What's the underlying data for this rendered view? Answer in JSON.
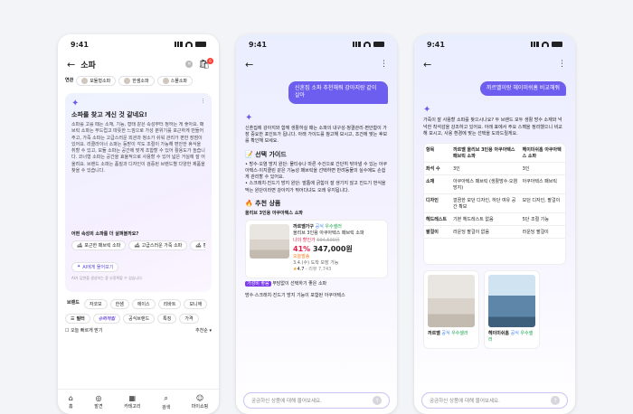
{
  "status_time": "9:41",
  "phone1": {
    "title": "소파",
    "cart_badge": "6",
    "related_label": "연관",
    "related": [
      "모듈형소파",
      "한샘소파",
      "스몰소파"
    ],
    "ai_title": "소파를 찾고 계신 것 같네요!",
    "ai_body": "소파를 고를 때는 소재, 기능, 형태 같은 속성부터 정하는 게 좋아요. 패브릭 소파는 부드럽고 따뜻한 느낌으로 가성 분위기를 포근하게 만들어주고, 가죽 소파는 고급스러운 외관과 청소가 쉬워 관리가 편한 장점이 있어요. 리클라이너 소파는 등받이 각도 조절이 가능해 편안한 휴식을 취할 수 있고, 모듈 소파는 공간에 맞게 조합할 수 있어 활용도가 높습니다. 코너형 소파는 공간을 효율적으로 사용할 수 있어 넓은 거실에 잘 어울려요. 브랜드 소파는 품질과 디자인이 검증된 브랜드별 다양한 제품을 찾을 수 있습니다.",
    "ai_question": "어떤 속성의 소파를 더 살펴볼까요?",
    "ai_chips": [
      "포근한 패브릭 소파",
      "고급스러운 가죽 소파",
      "편안"
    ],
    "ask_ai": "AI에게 물어보기",
    "beta_note": "AI가 답변을 생성하는 중 부정확할 수 있습니다.",
    "filter_row1": [
      "브랜드",
      "자코모",
      "한샘",
      "에이스",
      "리바트",
      "보니애"
    ],
    "filter_label": "필터",
    "filter_row2": [
      "슈퍼적립",
      "공식브랜드",
      "특징",
      "가격"
    ],
    "delivery": "오늘 빠르게 받기",
    "sort": "추천순",
    "nav": [
      "홈",
      "발견",
      "카테고리",
      "검색",
      "마이쇼핑"
    ]
  },
  "phone2": {
    "user_msg": "신혼집 소파 추천해줘 강아지랑 같이 살아",
    "intro": "신혼집에 강아지와 함께 생활하실 때는 소파의 내구성·청결관리·편안함이 가장 중요한 포인트가 됩니다. 아래 가이드를 참고해 보시고, 조건에 맞는 후보를 확인해 보세요.",
    "guide_title": "선택 가이드",
    "guide_items": [
      "방수·오염 방지 원단: 물티슈나 마른 수건으로 간단히 닦아낼 수 있는 아쿠아텍스·이지클린 같은 기능성 패브릭을 선택하면 반려동물의 실수에도 손쉽게 관리할 수 있어요.",
      "스크래치·진드기 방지 원단: 발톱에 긁힘이 잘 생기지 않고 진드기 번식을 막는 원단이라면 강아지가 뛰어다녀도 오래 유지됩니다."
    ],
    "rec_title": "추천 상품",
    "rec_sub": "올리브 3인용 아쿠아텍스 소파",
    "shop": "까르벨가구",
    "badge1": "공식",
    "badge2": "우수셀러",
    "prod_name": "올리브 3인용 아쿠아텍스 패브릭 소파",
    "coupon": "나의 할인가",
    "orig_price": "594,500원",
    "discount": "41%",
    "price": "347,000원",
    "shipping": "오늘발송",
    "ship_info": "3.4.(수) 도착 보장 가능",
    "rating": "4.7",
    "reviews": "리뷰 7,743",
    "tag": "가성비 좋음",
    "tag_desc": "부담없이 선택하기 좋은 소파",
    "tail": "방수·스크래치·진드기 방지 기능이 포함된 아쿠아텍스",
    "input_ph": "궁금하신 상품에 대해 물어보세요."
  },
  "phone3": {
    "user_msg": "까르벨이랑 헤이미쉬홈 비교해줘",
    "intro": "가죽이 잘 사용할 소파를 찾으시나요? 두 브랜드 모두 생활 방수 소재와 넉넉한 착석감을 강조하고 있어요. 아래 표에서 주요 스펙을 정리했으니 비교해 보시고, 사용 환경에 맞는 선택을 도와드릴게요.",
    "columns": [
      "항목",
      "까르벨 올리브 3인용 아쿠아텍스 패브릭 소파",
      "헤이미쉬홈 아쿠아텍스 소파"
    ],
    "rows": [
      [
        "좌석 수",
        "3인",
        "3인"
      ],
      [
        "소재",
        "아쿠아텍스 패브릭 (생활방수·오염 방지)",
        "아쿠아텍스 패브릭"
      ],
      [
        "디자인",
        "깔끔한 모던 디자인, 하단 여유 공간 확보",
        "모던 디자인, 팔걸이"
      ],
      [
        "헤드레스트",
        "기본 헤드레스트 없음",
        "5단 조절 기능"
      ],
      [
        "팔걸이",
        "라운딩 팔걸이 없음",
        "라운딩 팔걸이"
      ]
    ],
    "cards": [
      {
        "shop": "까르벨",
        "b1": "공식",
        "b2": "우수셀러"
      },
      {
        "shop": "헤이미쉬홈",
        "b1": "공식",
        "b2": "우수셀러"
      }
    ],
    "input_ph": "궁금하신 상품에 대해 물어보세요."
  }
}
